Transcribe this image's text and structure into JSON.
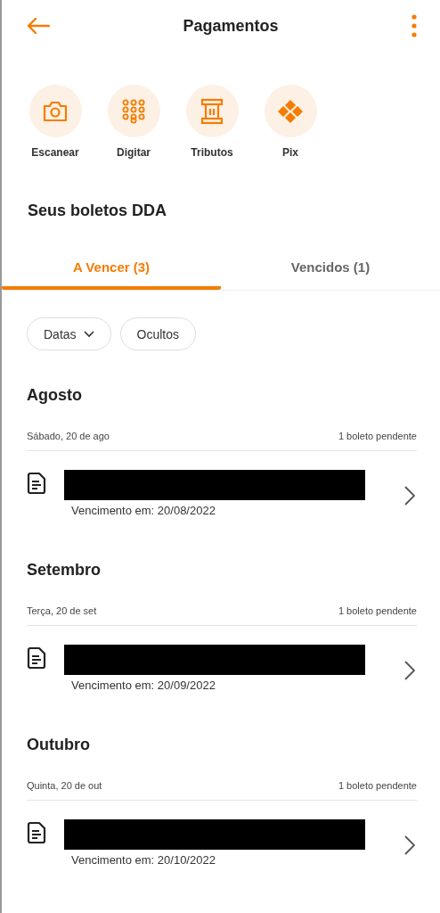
{
  "header": {
    "title": "Pagamentos"
  },
  "actions": [
    {
      "kind": "camera",
      "label": "Escanear"
    },
    {
      "kind": "keypad",
      "label": "Digitar"
    },
    {
      "kind": "pillar",
      "label": "Tributos"
    },
    {
      "kind": "pix",
      "label": "Pix"
    }
  ],
  "section_title": "Seus boletos DDA",
  "tabs": [
    {
      "label": "A Vencer (3)",
      "selected": true
    },
    {
      "label": "Vencidos (1)",
      "selected": false
    }
  ],
  "filters": [
    {
      "label": "Datas",
      "dropdown": true
    },
    {
      "label": "Ocultos",
      "dropdown": false
    }
  ],
  "months": [
    {
      "name": "Agosto",
      "day": "Sábado, 20 de ago",
      "count": "1 boleto pendente",
      "boletos": [
        {
          "redacted": true,
          "due": "Vencimento em: 20/08/2022"
        }
      ]
    },
    {
      "name": "Setembro",
      "day": "Terça, 20 de set",
      "count": "1 boleto pendente",
      "boletos": [
        {
          "redacted": true,
          "due": "Vencimento em: 20/09/2022"
        }
      ]
    },
    {
      "name": "Outubro",
      "day": "Quinta, 20 de out",
      "count": "1 boleto pendente",
      "boletos": [
        {
          "redacted": true,
          "due": "Vencimento em: 20/10/2022"
        }
      ]
    }
  ]
}
